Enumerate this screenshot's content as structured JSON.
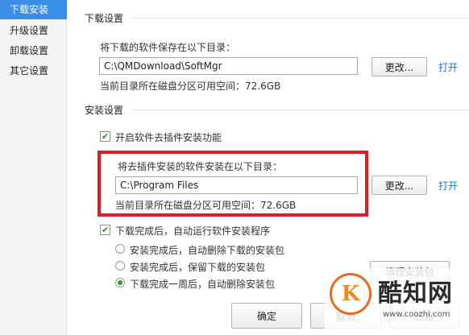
{
  "sidebar": {
    "items": [
      {
        "label": "下载安装",
        "active": true
      },
      {
        "label": "升级设置",
        "active": false
      },
      {
        "label": "卸载设置",
        "active": false
      },
      {
        "label": "其它设置",
        "active": false
      }
    ]
  },
  "download": {
    "section_title": "下载设置",
    "save_label": "将下载的软件保存在以下目录：",
    "path_value": "C:\\QMDownload\\SoftMgr",
    "change_button": "更改...",
    "open_link": "打开",
    "free_space": "当前目录所在磁盘分区可用空间：72.6GB"
  },
  "install": {
    "section_title": "安装设置",
    "plugin_checkbox_label": "开启软件去插件安装功能",
    "plugin_checked": true,
    "dir_label": "将去插件安装的软件安装在以下目录：",
    "path_value": "C:\\Program Files",
    "change_button": "更改...",
    "open_link": "打开",
    "free_space": "当前目录所在磁盘分区可用空间：72.6GB",
    "autorun_label": "下载完成后，自动运行软件安装程序",
    "autorun_checked": true,
    "radio_options": [
      {
        "label": "安装完成后，自动删除下载的安装包",
        "checked": false
      },
      {
        "label": "安装完成后，保留下载的安装包",
        "checked": false
      },
      {
        "label": "下载完成一周后，自动删除安装包",
        "checked": true
      }
    ],
    "clear_button": "清理安装包"
  },
  "footer": {
    "ok_button": "确定",
    "cancel_button": "取消",
    "apply_button": "应用"
  },
  "watermark": {
    "logo_letter": "K",
    "name": "酷知网",
    "url": "www.coozhi.com"
  },
  "colors": {
    "highlight_box": "#d61f26",
    "sidebar_active": "#3a8ee6",
    "link": "#1a73c9"
  }
}
